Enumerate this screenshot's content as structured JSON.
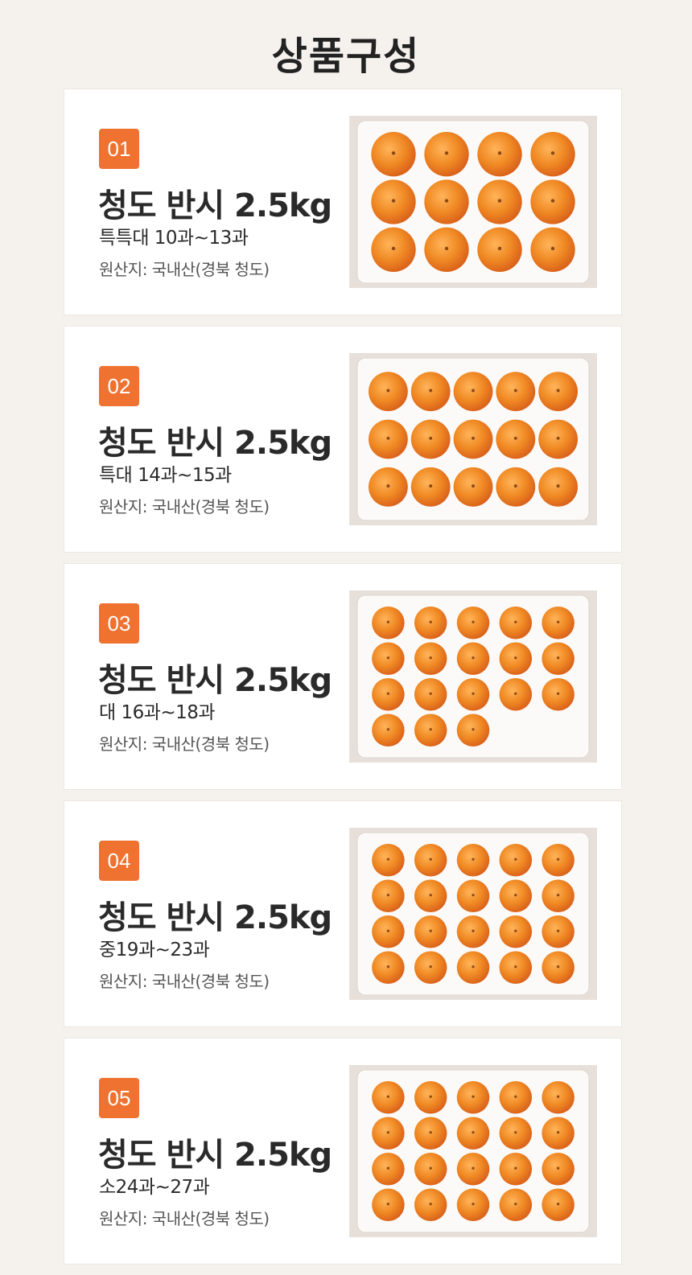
{
  "page": {
    "title": "상품구성"
  },
  "products": [
    {
      "num": "01",
      "name": "청도 반시 2.5kg",
      "grade": "특특대 10과~13과",
      "origin": "원산지: 국내산(경북 청도)",
      "image_icon": "persimmon-box-photo",
      "fruit_count": 12,
      "grid": [
        4,
        3
      ]
    },
    {
      "num": "02",
      "name": "청도 반시 2.5kg",
      "grade": "특대 14과~15과",
      "origin": "원산지: 국내산(경북 청도)",
      "image_icon": "persimmon-box-photo",
      "fruit_count": 15,
      "grid": [
        5,
        3
      ]
    },
    {
      "num": "03",
      "name": "청도 반시 2.5kg",
      "grade": "대 16과~18과",
      "origin": "원산지: 국내산(경북 청도)",
      "image_icon": "persimmon-box-photo",
      "fruit_count": 18,
      "grid": [
        5,
        4
      ]
    },
    {
      "num": "04",
      "name": "청도 반시 2.5kg",
      "grade": "중19과~23과",
      "origin": "원산지: 국내산(경북 청도)",
      "image_icon": "persimmon-box-photo",
      "fruit_count": 20,
      "grid": [
        5,
        4
      ]
    },
    {
      "num": "05",
      "name": "청도 반시 2.5kg",
      "grade": "소24과~27과",
      "origin": "원산지: 국내산(경북 청도)",
      "image_icon": "persimmon-box-photo",
      "fruit_count": 20,
      "grid": [
        5,
        4
      ]
    }
  ],
  "colors": {
    "accent": "#f07230",
    "background": "#f5f1ed",
    "card": "#ffffff",
    "fruit": "#f08a24",
    "tray": "#fbfaf8"
  }
}
